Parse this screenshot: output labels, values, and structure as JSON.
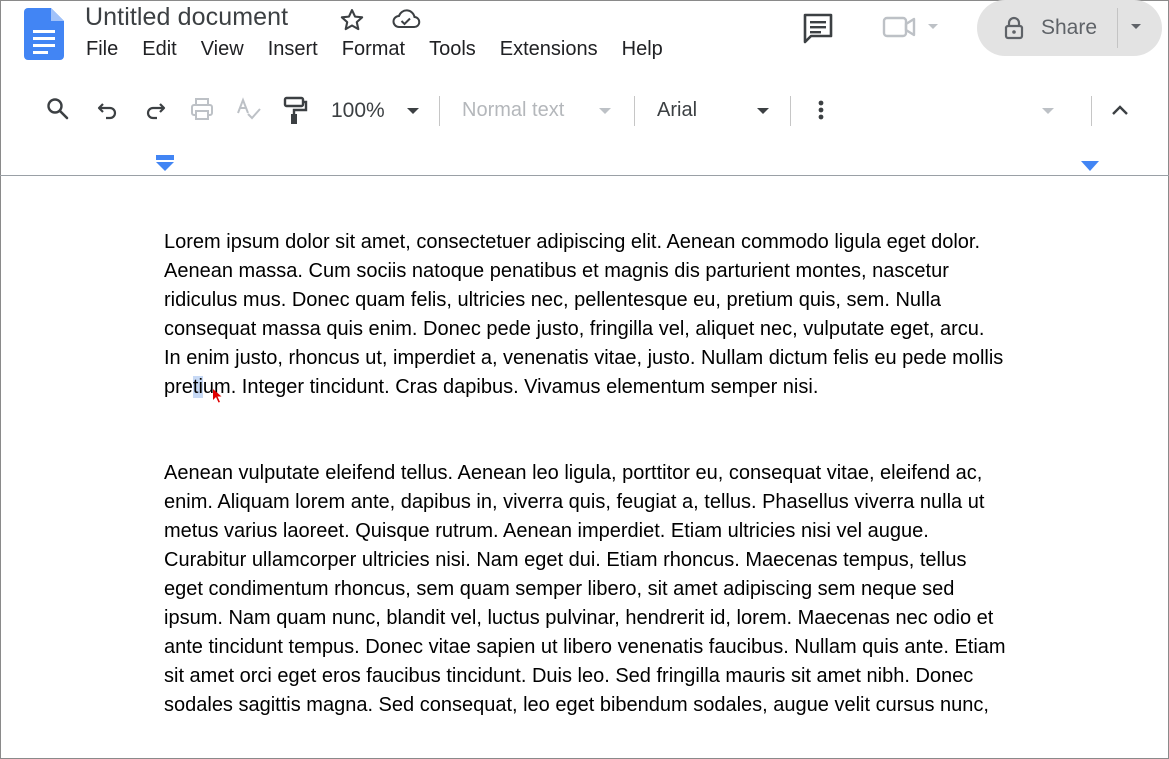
{
  "header": {
    "title": "Untitled document",
    "menu": [
      "File",
      "Edit",
      "View",
      "Insert",
      "Format",
      "Tools",
      "Extensions",
      "Help"
    ],
    "share_label": "Share"
  },
  "toolbar": {
    "zoom": "100%",
    "paragraph_style": "Normal text",
    "font": "Arial"
  },
  "document": {
    "paragraph1": {
      "lines": [
        "Lorem ipsum dolor sit amet, consectetuer adipiscing elit. Aenean commodo ligula eget dolor.",
        "Aenean massa. Cum sociis natoque penatibus et magnis dis parturient montes, nascetur",
        "ridiculus mus. Donec quam felis, ultricies nec, pellentesque eu, pretium quis, sem. Nulla",
        "consequat massa quis enim. Donec pede justo, fringilla vel, aliquet nec, vulputate eget, arcu.",
        "In enim justo, rhoncus ut, imperdiet a, venenatis vitae, justo. Nullam dictum felis eu pede mollis"
      ],
      "last_line_before": "pre",
      "last_line_selected": "ti",
      "last_line_after": "um. Integer tincidunt. Cras dapibus. Vivamus elementum semper nisi."
    },
    "paragraph2": {
      "lines": [
        "Aenean vulputate eleifend tellus. Aenean leo ligula, porttitor eu, consequat vitae, eleifend ac,",
        "enim. Aliquam lorem ante, dapibus in, viverra quis, feugiat a, tellus. Phasellus viverra nulla ut",
        "metus varius laoreet. Quisque rutrum. Aenean imperdiet. Etiam ultricies nisi vel augue.",
        "Curabitur ullamcorper ultricies nisi. Nam eget dui. Etiam rhoncus. Maecenas tempus, tellus",
        "eget condimentum rhoncus, sem quam semper libero, sit amet adipiscing sem neque sed",
        "ipsum. Nam quam nunc, blandit vel, luctus pulvinar, hendrerit id, lorem. Maecenas nec odio et",
        "ante tincidunt tempus. Donec vitae sapien ut libero venenatis faucibus. Nullam quis ante. Etiam",
        "sit amet orci eget eros faucibus tincidunt. Duis leo. Sed fringilla mauris sit amet nibh. Donec",
        "sodales sagittis magna. Sed consequat, leo eget bibendum sodales, augue velit cursus nunc,"
      ]
    }
  },
  "icons": {
    "app": "google-docs-icon",
    "star": "star-icon",
    "cloud": "cloud-saved-icon",
    "comments": "comments-icon",
    "meet": "video-camera-icon",
    "lock": "lock-icon",
    "search": "search-icon",
    "undo": "undo-icon",
    "redo": "redo-icon",
    "print": "print-icon",
    "spellcheck": "spellcheck-icon",
    "paint_format": "paint-format-icon",
    "more": "more-vertical-icon",
    "collapse": "chevron-up-icon",
    "cursor": "mouse-cursor-icon"
  },
  "colors": {
    "docs_blue": "#4285f4",
    "selection": "#c7d9f5",
    "share_bg": "#e3e3e3",
    "ruler_marker": "#4285f4",
    "cursor": "#e00000"
  }
}
